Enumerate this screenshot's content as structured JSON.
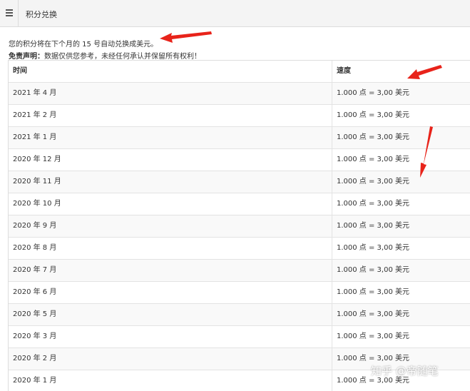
{
  "header": {
    "title": "积分兑换",
    "menu_icon": "menu-list-icon"
  },
  "notice_text": "您的积分将在下个月的 15 号自动兑换成美元。",
  "disclaimer": {
    "label": "免责声明：",
    "text": "数据仅供您参考，未经任何承认并保留所有权利！"
  },
  "table": {
    "columns": [
      "时间",
      "速度"
    ],
    "rows": [
      [
        "2021 年 4 月",
        "1.000 点 = 3,00 美元"
      ],
      [
        "2021 年 2 月",
        "1.000 点 = 3,00 美元"
      ],
      [
        "2021 年 1 月",
        "1.000 点 = 3,00 美元"
      ],
      [
        "2020 年 12 月",
        "1.000 点 = 3,00 美元"
      ],
      [
        "2020 年 11 月",
        "1.000 点 = 3,00 美元"
      ],
      [
        "2020 年 10 月",
        "1.000 点 = 3,00 美元"
      ],
      [
        "2020 年 9 月",
        "1.000 点 = 3,00 美元"
      ],
      [
        "2020 年 8 月",
        "1.000 点 = 3,00 美元"
      ],
      [
        "2020 年 7 月",
        "1.000 点 = 3,00 美元"
      ],
      [
        "2020 年 6 月",
        "1.000 点 = 3,00 美元"
      ],
      [
        "2020 年 5 月",
        "1.000 点 = 3,00 美元"
      ],
      [
        "2020 年 3 月",
        "1.000 点 = 3,00 美元"
      ],
      [
        "2020 年 2 月",
        "1.000 点 = 3,00 美元"
      ],
      [
        "2020 年 1 月",
        "1.000 点 = 3,00 美元"
      ]
    ]
  },
  "annotation_color": "#e8231a",
  "watermark": "知乎 @帝随笔"
}
